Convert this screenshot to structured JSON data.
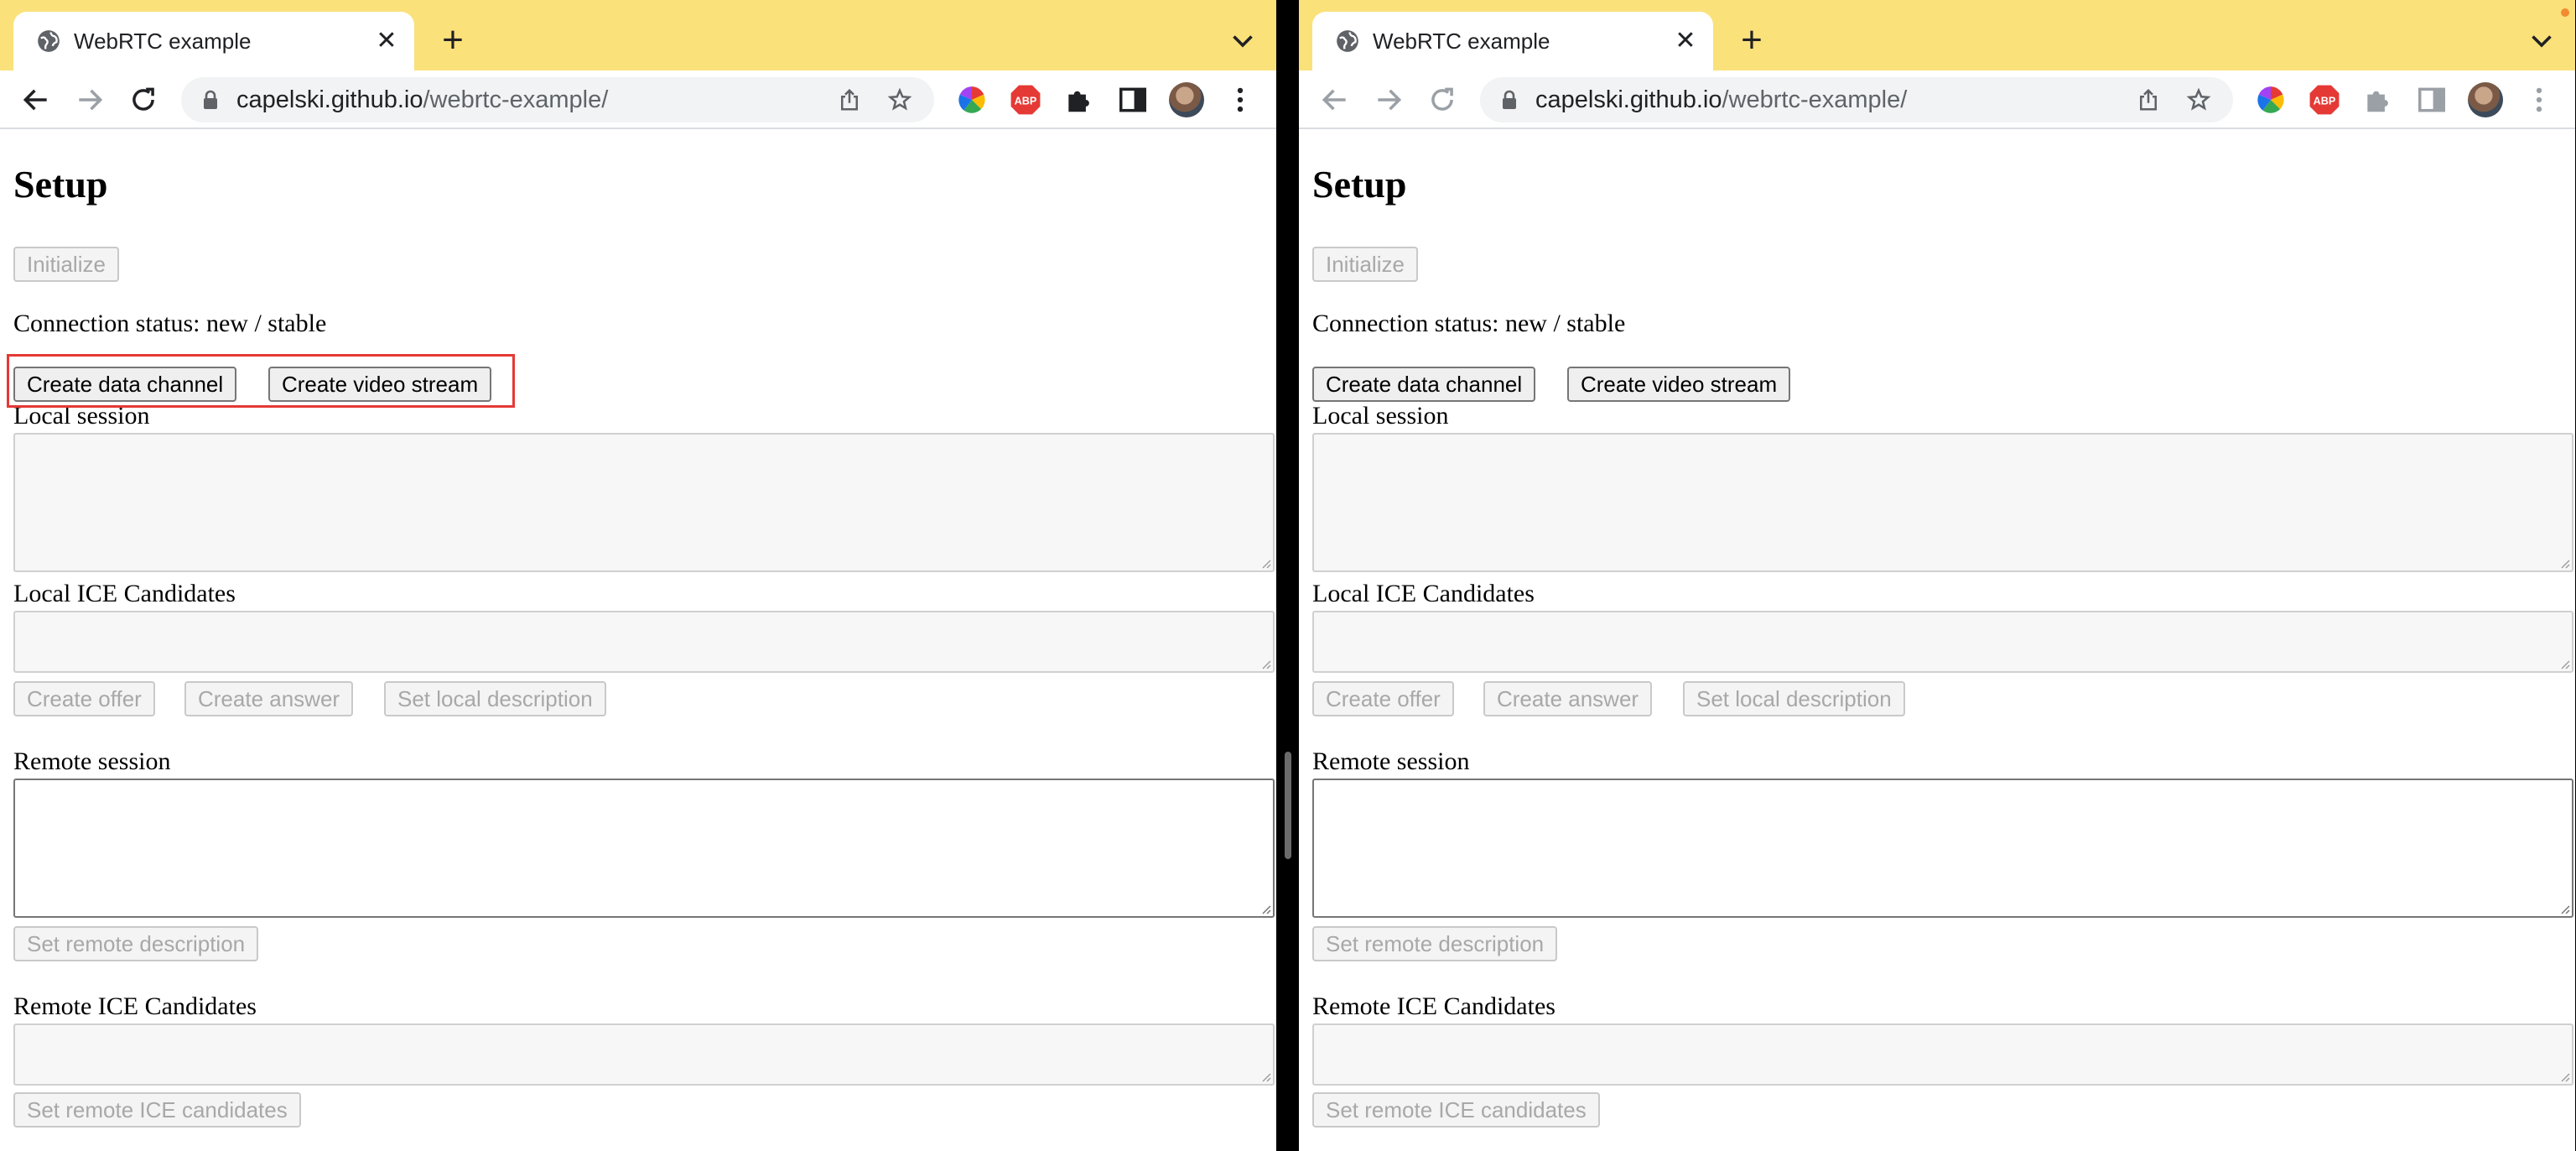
{
  "browser": {
    "tab_title": "WebRTC example",
    "url_host": "capelski.github.io",
    "url_path": "/webrtc-example/",
    "accent_color": "#fae17a"
  },
  "icons": [
    "globe-icon",
    "close-icon",
    "plus-icon",
    "chevron-down-icon",
    "back-icon",
    "forward-icon",
    "reload-icon",
    "lock-icon",
    "share-icon",
    "star-icon",
    "color-wheel-extension-icon",
    "adblock-plus-icon",
    "puzzle-icon",
    "side-panel-icon",
    "kebab-menu-icon"
  ],
  "page": {
    "heading": "Setup",
    "initialize_button": "Initialize",
    "connection_status": "Connection status: new / stable",
    "create_data_channel_button": "Create data channel",
    "create_video_stream_button": "Create video stream",
    "local_session_label": "Local session",
    "local_ice_label": "Local ICE Candidates",
    "create_offer_button": "Create offer",
    "create_answer_button": "Create answer",
    "set_local_description_button": "Set local description",
    "remote_session_label": "Remote session",
    "set_remote_description_button": "Set remote description",
    "remote_ice_label": "Remote ICE Candidates",
    "set_remote_ice_button": "Set remote ICE candidates"
  },
  "highlight_color": "#e53935"
}
